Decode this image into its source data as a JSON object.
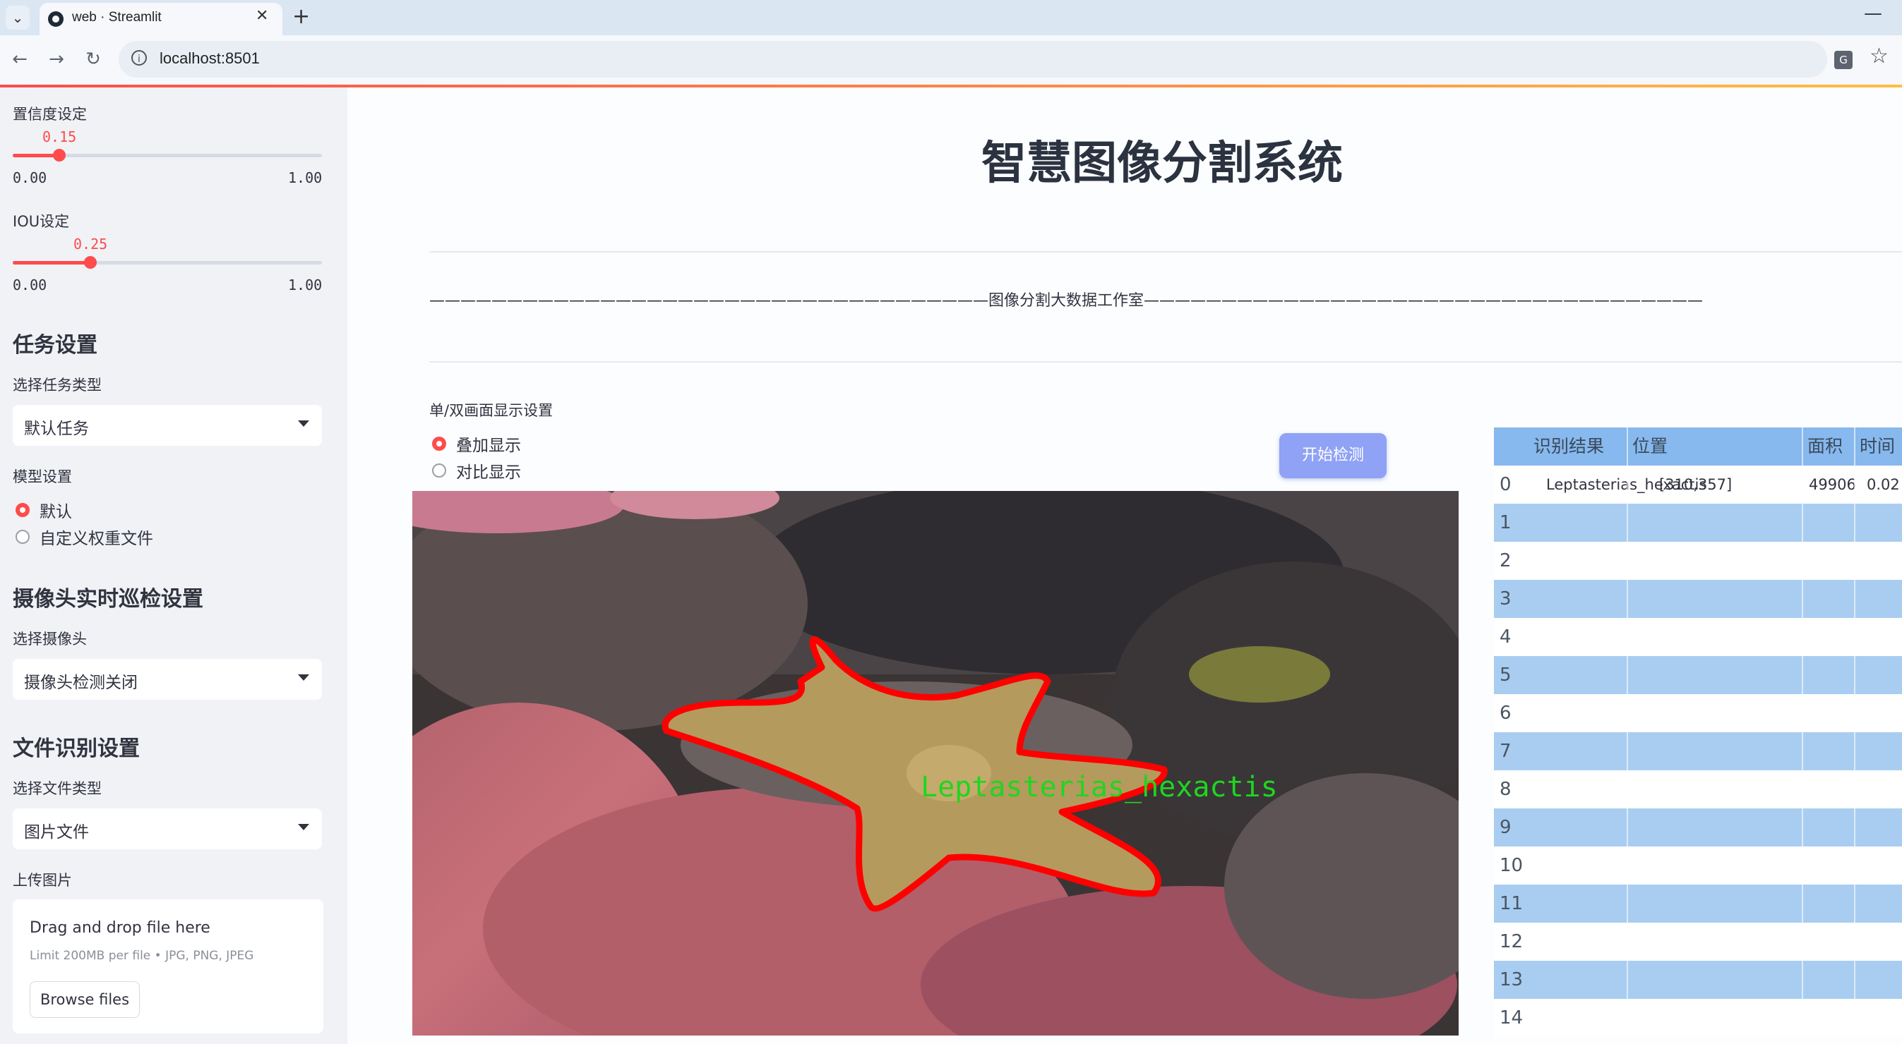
{
  "browser": {
    "tab_title": "web · Streamlit",
    "url": "localhost:8501"
  },
  "sidebar": {
    "confidence": {
      "label": "置信度设定",
      "value": "0.15",
      "min": "0.00",
      "max": "1.00",
      "fraction": 0.15
    },
    "iou": {
      "label": "IOU设定",
      "value": "0.25",
      "min": "0.00",
      "max": "1.00",
      "fraction": 0.25
    },
    "task_header": "任务设置",
    "task_type_label": "选择任务类型",
    "task_type_value": "默认任务",
    "model_label": "模型设置",
    "model_options": [
      "默认",
      "自定义权重文件"
    ],
    "camera_header": "摄像头实时巡检设置",
    "camera_label": "选择摄像头",
    "camera_value": "摄像头检测关闭",
    "file_header": "文件识别设置",
    "file_type_label": "选择文件类型",
    "file_type_value": "图片文件",
    "upload_label": "上传图片",
    "upload_drag": "Drag and drop file here",
    "upload_limit": "Limit 200MB per file • JPG, PNG, JPEG",
    "upload_button": "Browse files"
  },
  "main": {
    "title": "智慧图像分割系统",
    "banner": "————————————————————————————————————图像分割大数据工作室————————————————————————————————————",
    "display_label": "单/双画面显示设置",
    "display_options": [
      "叠加显示",
      "对比显示"
    ],
    "start_button": "开始检测",
    "detection_label": "Leptasterias_hexactis"
  },
  "table": {
    "columns": [
      "识别结果",
      "位置",
      "面积",
      "时间"
    ],
    "first_row": {
      "index": "0",
      "result": "Leptasterias_hexactis",
      "position": "[310,357]",
      "area": "49906",
      "time": "0.02"
    },
    "indices": [
      "1",
      "2",
      "3",
      "4",
      "5",
      "6",
      "7",
      "8",
      "9",
      "10",
      "11",
      "12",
      "13",
      "14"
    ]
  },
  "colors": {
    "accent": "#ff4b4b",
    "button": "#8fa2f5",
    "table_alt": "#a9cdf1",
    "mask_outline": "#ff0000",
    "label_green": "#1fd61f"
  }
}
